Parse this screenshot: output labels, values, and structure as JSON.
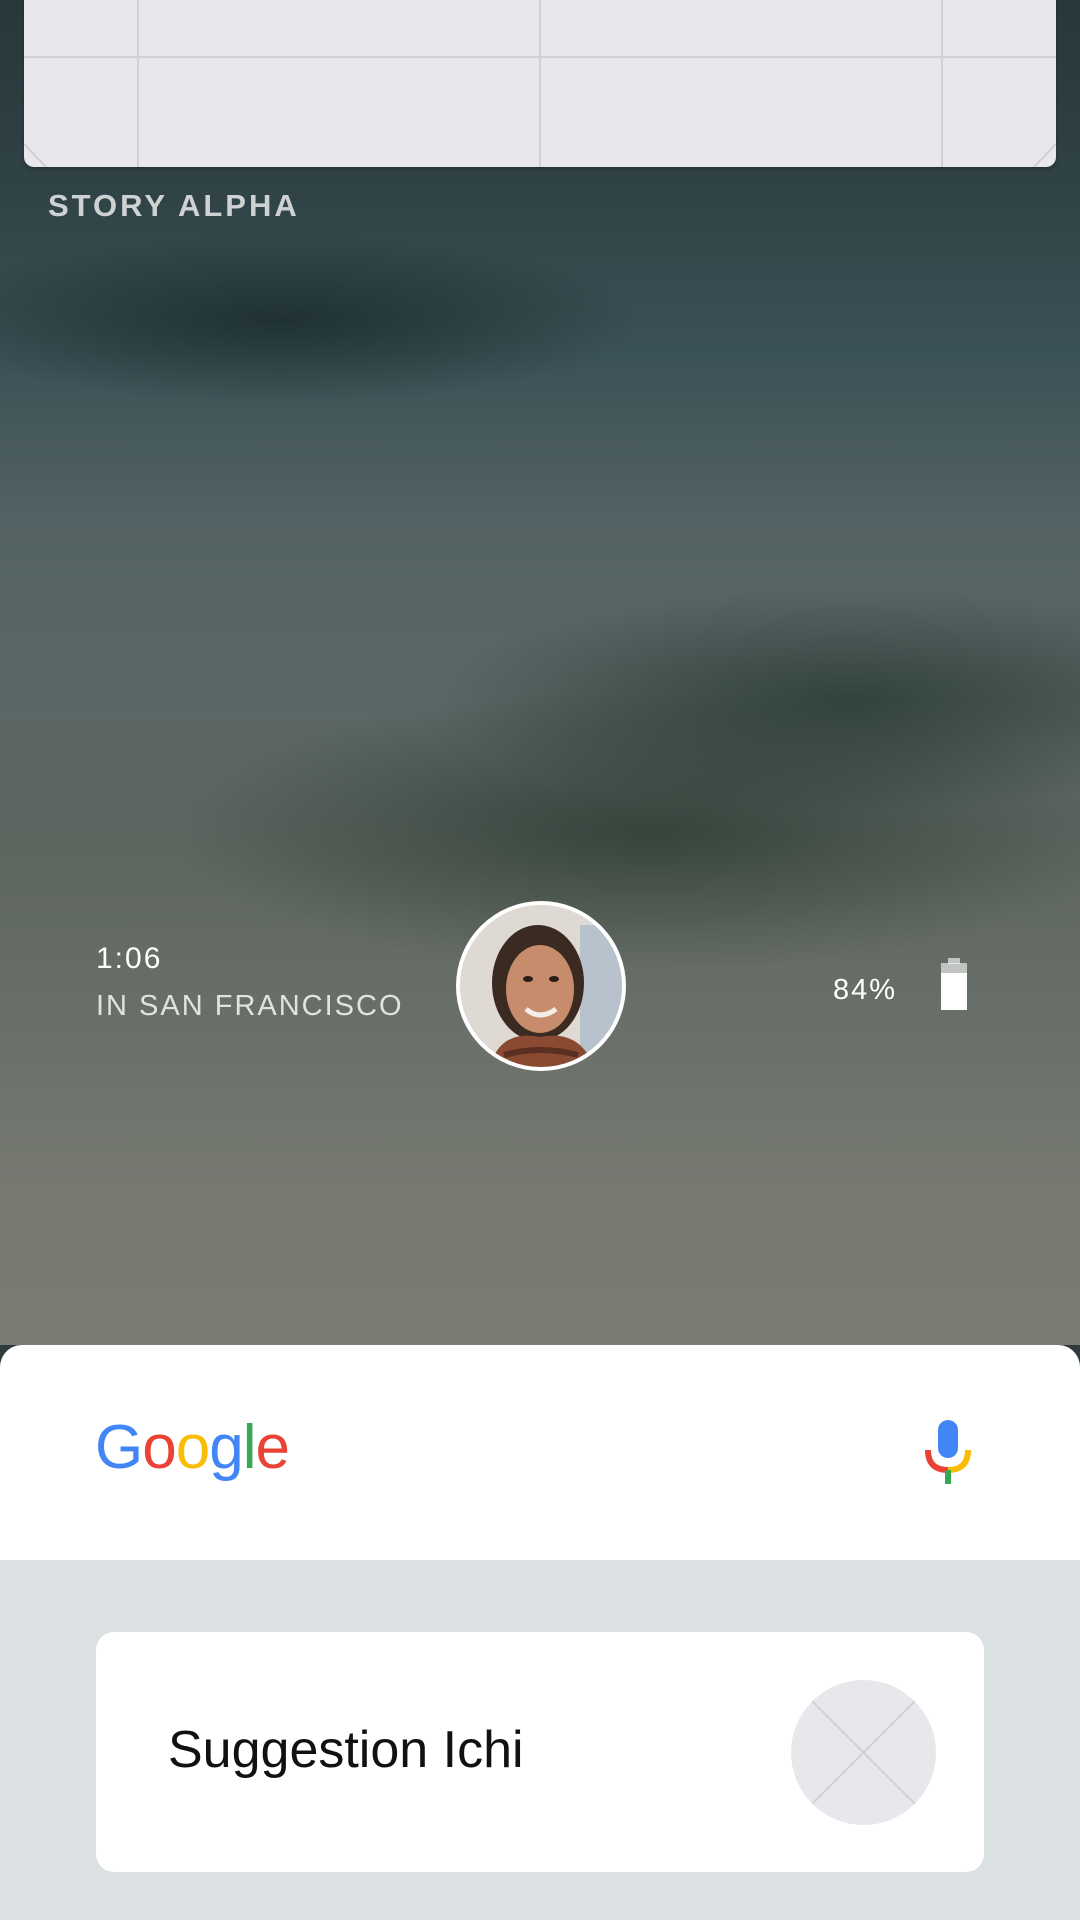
{
  "story": {
    "title": "STORY ALPHA"
  },
  "info": {
    "time": "1:06",
    "location": "IN SAN FRANCISCO",
    "battery": "84%"
  },
  "search": {
    "logo_text": [
      "G",
      "o",
      "o",
      "g",
      "l",
      "e"
    ],
    "logo_colors": [
      "#4285F4",
      "#EA4335",
      "#FBBC05",
      "#4285F4",
      "#34A853",
      "#EA4335"
    ],
    "mic_icon": "microphone-icon"
  },
  "suggestion": {
    "label": "Suggestion Ichi"
  },
  "colors": {
    "card_bg": "#e8e7ec",
    "suggest_area_bg": "#dbe0e3"
  }
}
